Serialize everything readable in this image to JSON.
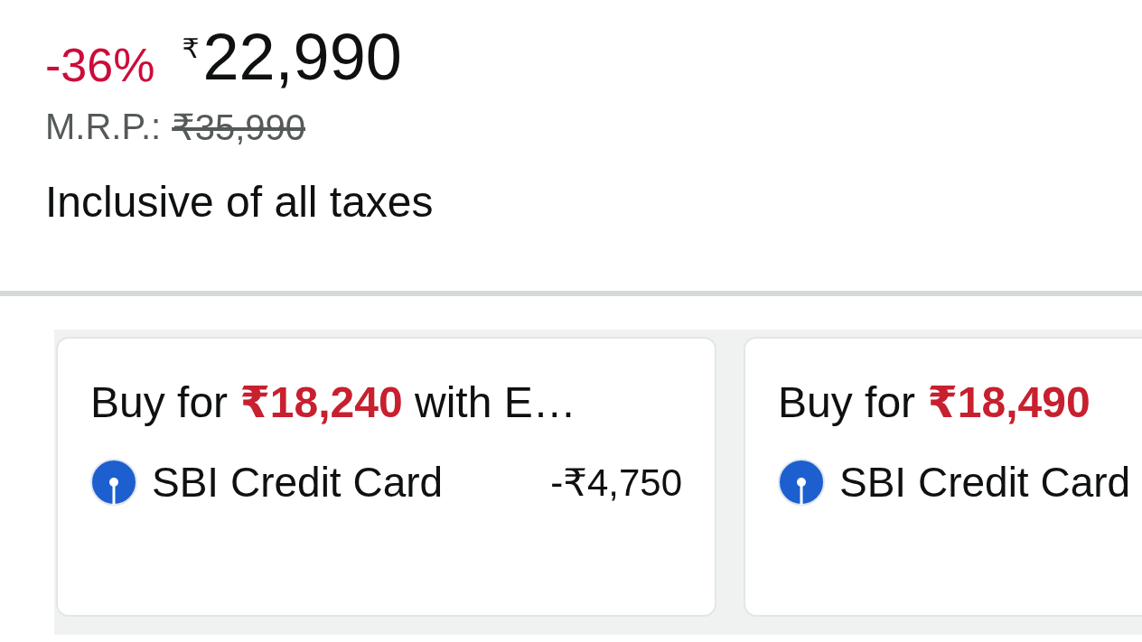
{
  "price": {
    "discount": "-36%",
    "currency": "₹",
    "amount": "22,990"
  },
  "mrp": {
    "label": "M.R.P.:",
    "value": "₹35,990"
  },
  "tax_note": "Inclusive of all taxes",
  "offers": [
    {
      "title": "Buy for **₹18,240** with E…",
      "bank": "SBI Credit Card",
      "discount": "-₹4,750"
    },
    {
      "title": "Buy for **₹18,490**",
      "bank": "SBI Credit Card"
    }
  ]
}
